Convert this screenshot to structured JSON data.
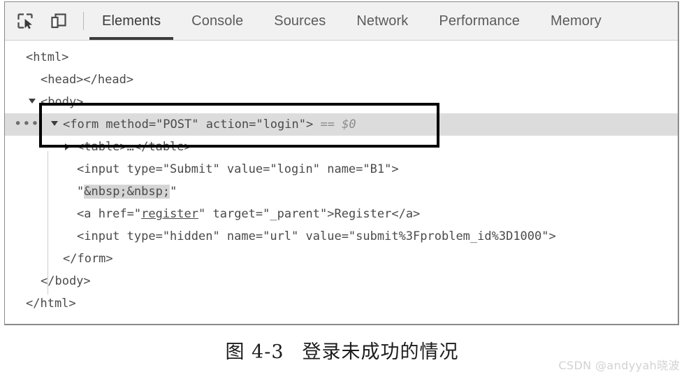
{
  "toolbar": {
    "icons": [
      {
        "name": "inspect-element-icon",
        "label": "Inspect element"
      },
      {
        "name": "device-toolbar-icon",
        "label": "Toggle device toolbar"
      }
    ],
    "tabs": [
      {
        "label": "Elements",
        "active": true
      },
      {
        "label": "Console",
        "active": false
      },
      {
        "label": "Sources",
        "active": false
      },
      {
        "label": "Network",
        "active": false
      },
      {
        "label": "Performance",
        "active": false
      },
      {
        "label": "Memory",
        "active": false
      }
    ]
  },
  "dom_tree": {
    "gutter_dots": "•••",
    "rows": [
      {
        "text": "<html>"
      },
      {
        "text": "<head></head>"
      },
      {
        "text": "<body>"
      },
      {
        "text_before": "<form method=\"POST\" action=\"login\">",
        "eq": " == ",
        "dollar": "$0"
      },
      {
        "text": "<table>…</table>"
      },
      {
        "text": "<input type=\"Submit\" value=\"login\" name=\"B1\">"
      },
      {
        "quote_open": "\"",
        "highlight": "&nbsp;&nbsp;",
        "quote_close": "\""
      },
      {
        "a_before": "<a href=\"",
        "a_link": "register",
        "a_after": "\" target=\"_parent\">Register</a>"
      },
      {
        "text": "<input type=\"hidden\" name=\"url\" value=\"submit%3Fproblem_id%3D1000\">"
      },
      {
        "text": "</form>"
      },
      {
        "text": "</body>"
      },
      {
        "text": "</html>"
      }
    ]
  },
  "caption": {
    "figure_number": "图 4-3",
    "title": "登录未成功的情况"
  },
  "watermark": {
    "text": "CSDN @andyyah晓波"
  },
  "colors": {
    "toolbar_bg": "#f1f1f1",
    "selected_row": "#dcdcdc",
    "text": "#4a4a4a",
    "annotation": "#000000",
    "watermark": "#d2d2d2"
  }
}
